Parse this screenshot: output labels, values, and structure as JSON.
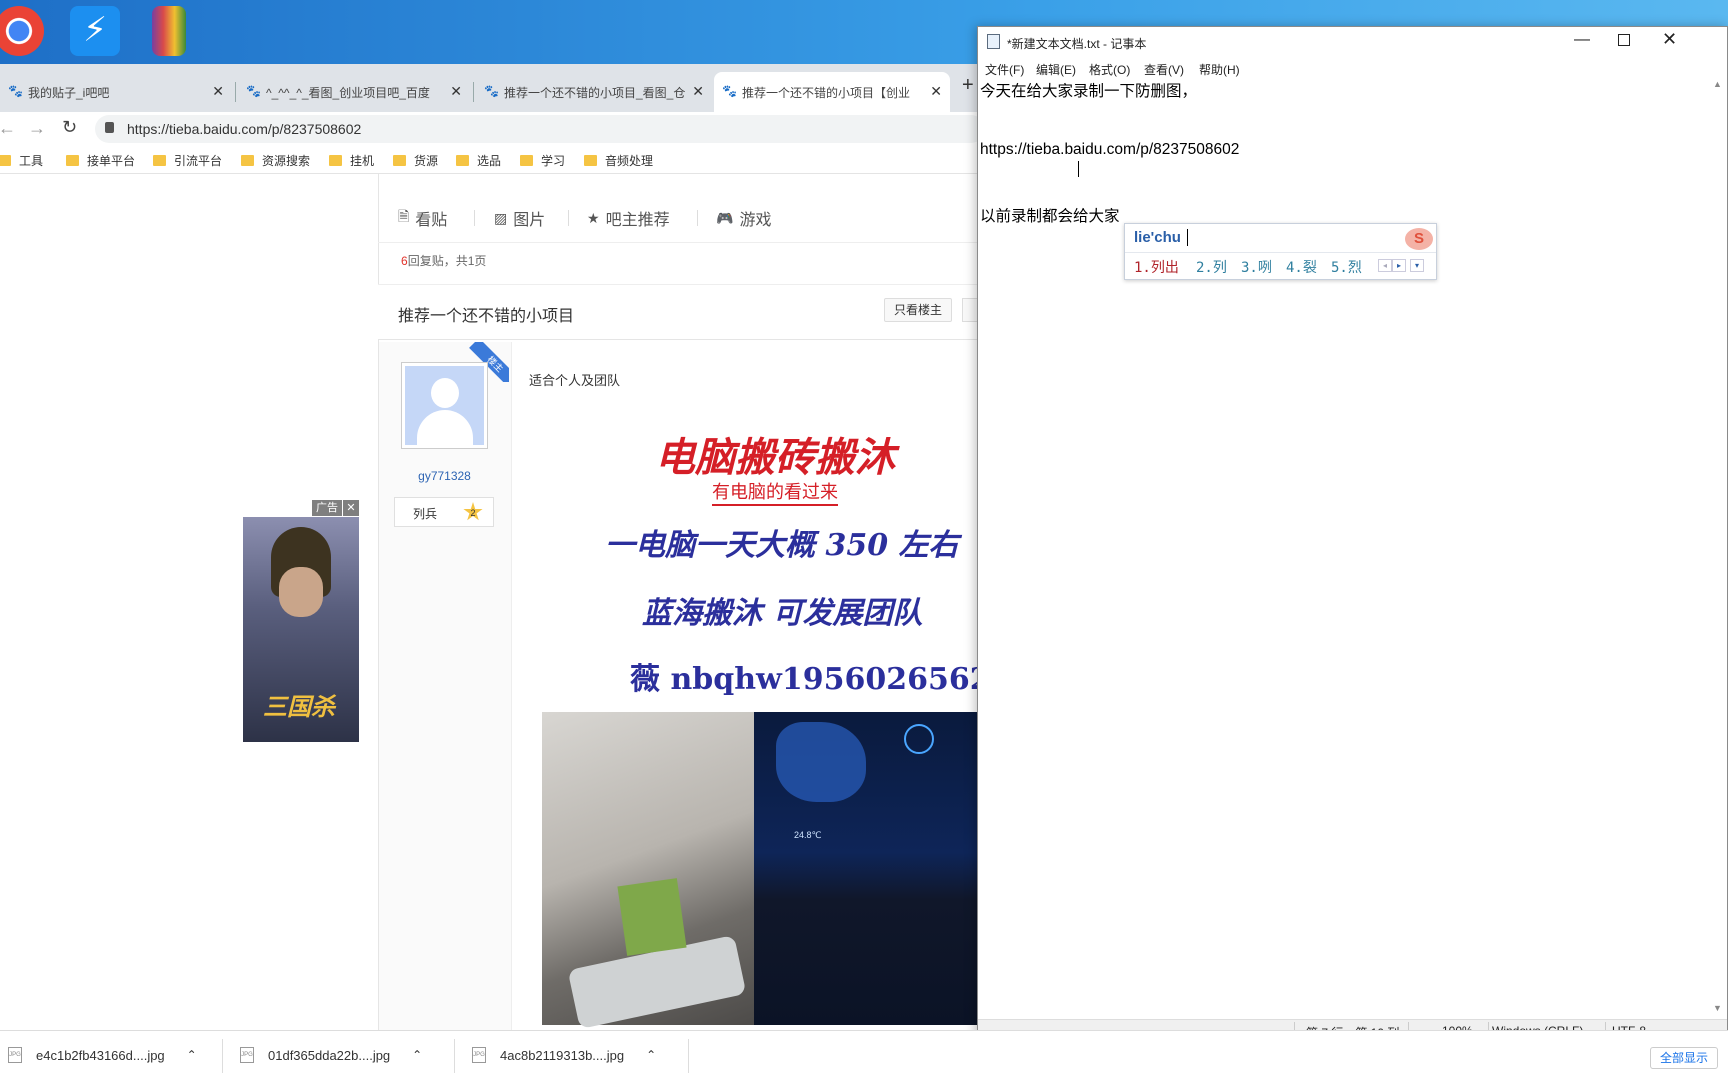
{
  "browser": {
    "tabs": [
      {
        "label": "我的贴子_i吧吧",
        "active": false
      },
      {
        "label": "^_^^_^_看图_创业项目吧_百度",
        "active": false
      },
      {
        "label": "推荐一个还不错的小项目_看图_仓",
        "active": false
      },
      {
        "label": "推荐一个还不错的小项目【创业",
        "active": true
      }
    ],
    "url": "https://tieba.baidu.com/p/8237508602",
    "bookmarks": [
      "工具",
      "接单平台",
      "引流平台",
      "资源搜索",
      "挂机",
      "货源",
      "选品",
      "学习",
      "音频处理"
    ]
  },
  "tieba": {
    "nav_tabs": [
      {
        "label": "看贴",
        "icon": "document-icon"
      },
      {
        "label": "图片",
        "icon": "image-icon"
      },
      {
        "label": "吧主推荐",
        "icon": "star-icon"
      },
      {
        "label": "游戏",
        "icon": "gamepad-icon"
      }
    ],
    "reply_count": "6",
    "reply_suffix": "回复贴，共1页",
    "thread_title": "推荐一个还不错的小项目",
    "only_op_button": "只看楼主",
    "op_badge": "楼主",
    "author_name": "gy771328",
    "author_level_name": "列兵",
    "author_level": "2",
    "post_text": "适合个人及团队",
    "poster_lines": [
      "电脑搬砖搬沐",
      "有电脑的看过来",
      "一电脑一天大概 350 左右",
      "蓝海搬沐 可发展团队",
      "薇 nbqhw1956026562"
    ],
    "ad_label": "广告",
    "ad_game_text": "三国杀",
    "photo_temp": "24.8℃"
  },
  "notepad": {
    "title": "*新建文本文档.txt - 记事本",
    "menu": [
      "文件(F)",
      "编辑(E)",
      "格式(O)",
      "查看(V)",
      "帮助(H)"
    ],
    "lines": [
      "今天在给大家录制一下防删图，",
      "",
      "https://tieba.baidu.com/p/8237508602",
      "",
      "以前录制都会给大家"
    ],
    "status": {
      "position": "第 7 行，第 10 列",
      "zoom": "100%",
      "line_ending": "Windows (CRLF)",
      "encoding": "UTF-8"
    }
  },
  "ime": {
    "input": "lie'chu",
    "candidates": [
      "1.列出",
      "2.列",
      "3.咧",
      "4.裂",
      "5.烈"
    ]
  },
  "downloads": {
    "items": [
      "e4c1b2fb43166d....jpg",
      "01df365dda22b....jpg",
      "4ac8b2119313b....jpg"
    ],
    "show_all": "全部显示"
  }
}
